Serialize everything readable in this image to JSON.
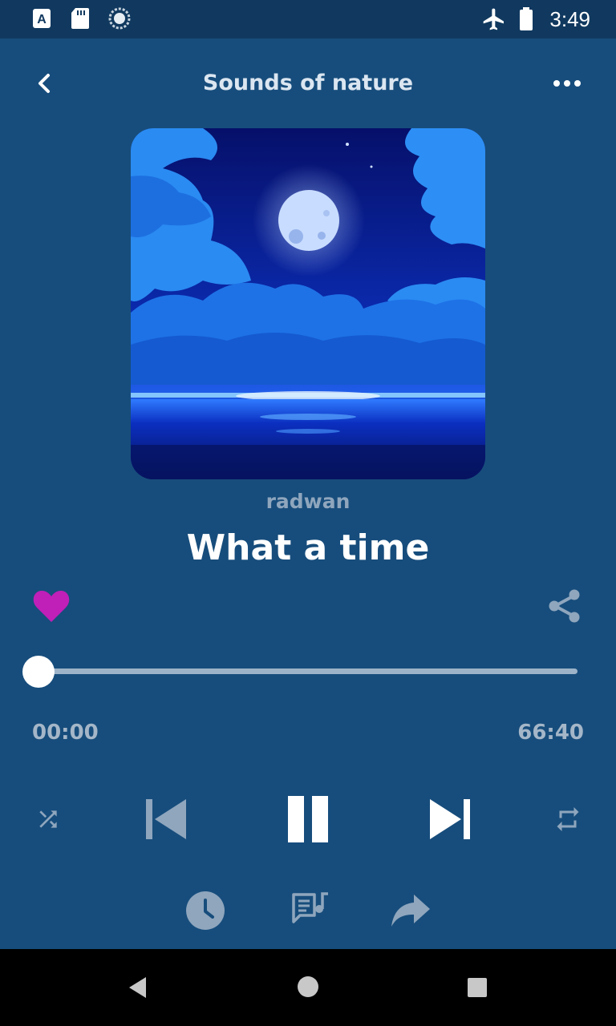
{
  "status_bar": {
    "time": "3:49",
    "icons": [
      "text-a-icon",
      "sd-card-icon",
      "sync-circle-icon",
      "airplane-mode-icon",
      "battery-icon"
    ]
  },
  "header": {
    "title": "Sounds of nature",
    "back_icon": "chevron-left-icon",
    "menu_icon": "more-horizontal-icon"
  },
  "track": {
    "artist": "radwan",
    "title": "What a time",
    "artwork": "night-moon-ocean-artwork",
    "liked": true
  },
  "player": {
    "elapsed": "00:00",
    "duration": "66:40",
    "progress": 0.0
  },
  "controls": [
    "shuffle-icon",
    "skip-previous-icon",
    "pause-icon",
    "skip-next-icon",
    "repeat-icon"
  ],
  "extras": [
    "sleep-timer-icon",
    "lyrics-icon",
    "forward-share-icon"
  ],
  "colors": {
    "background": "#174d7c",
    "status_bar": "#11395f",
    "heart": "#c01fb8",
    "muted_icon": "#8fa6bd",
    "track": "#9db3c8"
  }
}
